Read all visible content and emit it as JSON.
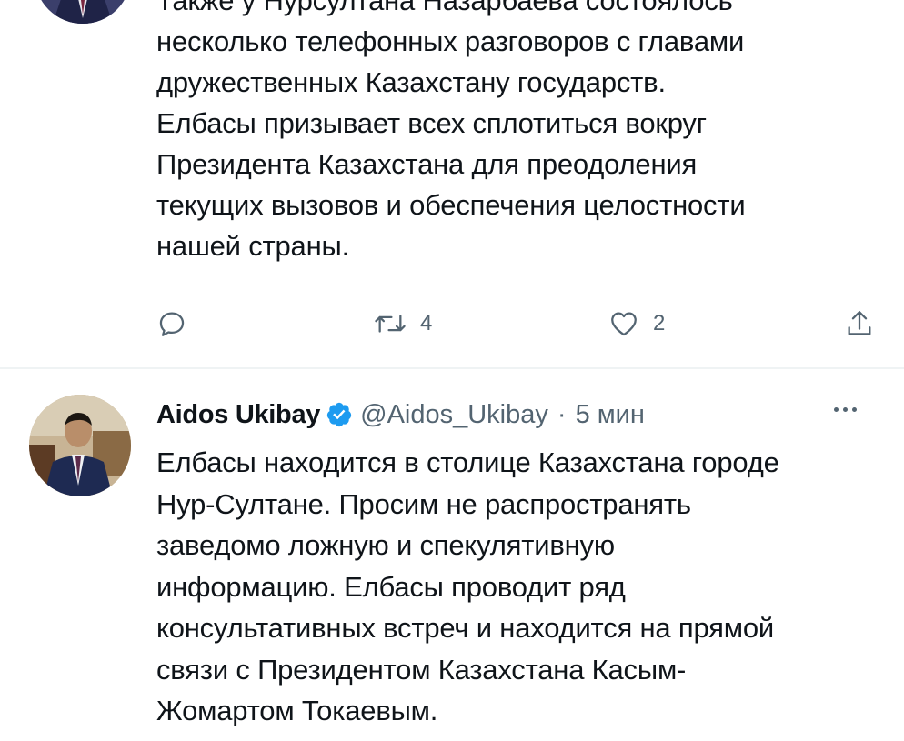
{
  "tweet_top": {
    "text_lines": [
      "Также у Нурсултана Назарбаева состоялось",
      "несколько телефонных разговоров с главами",
      "дружественных Казахстану государств.",
      "Елбасы призывает всех сплотиться вокруг",
      "Президента Казахстана для преодоления",
      "текущих вызовов и обеспечения целостности",
      "нашей страны."
    ],
    "actions": {
      "reply_icon": "reply-icon",
      "retweet_icon": "retweet-icon",
      "retweet_count": "4",
      "like_icon": "heart-icon",
      "like_count": "2",
      "share_icon": "share-icon"
    }
  },
  "tweet_main": {
    "author_name": "Aidos Ukibay",
    "verified_icon": "verified-badge-icon",
    "handle": "@Aidos_Ukibay",
    "separator": "·",
    "time": "5 мин",
    "more_icon": "more-options-icon",
    "text_lines": [
      "Елбасы находится в столице Казахстана городе",
      "Нур-Султане. Просим не распространять",
      "заведомо ложную и спекулятивную",
      "информацию. Елбасы проводит ряд",
      "консультативных встреч и находится на прямой",
      "связи с Президентом Казахстана Касым-",
      "Жомартом Токаевым."
    ]
  },
  "colors": {
    "text": "#0f1419",
    "secondary": "#536471",
    "verified": "#1d9bf0",
    "divider": "#eff3f4"
  }
}
